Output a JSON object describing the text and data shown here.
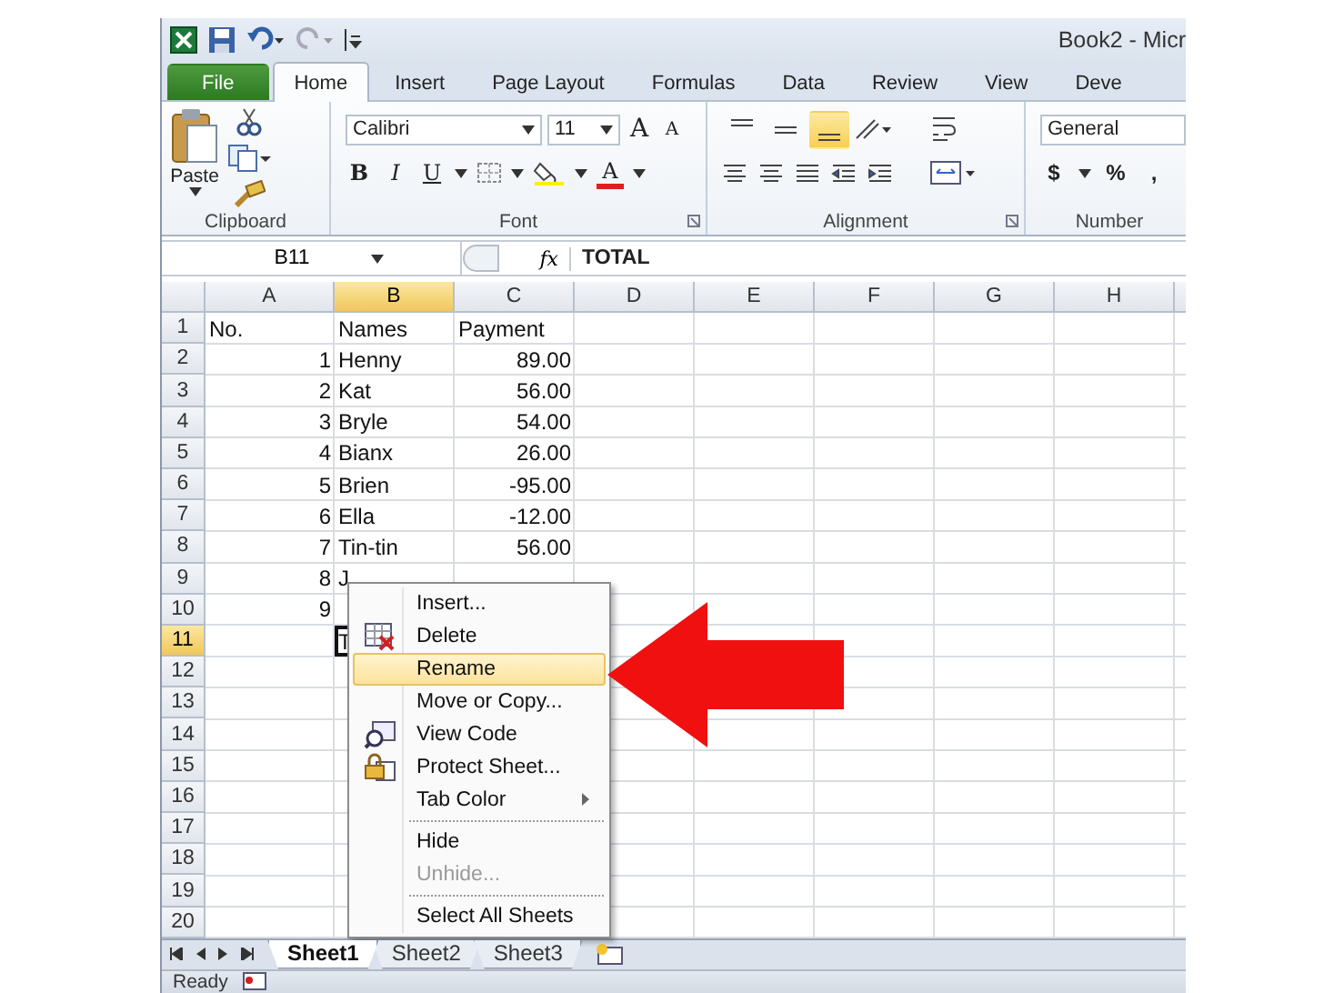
{
  "title_bar": {
    "title": "Book2 - Micr"
  },
  "ribbon_tabs": [
    {
      "label": "File",
      "kind": "file",
      "selected": false
    },
    {
      "label": "Home",
      "kind": "tab",
      "selected": true
    },
    {
      "label": "Insert",
      "kind": "tab",
      "selected": false
    },
    {
      "label": "Page Layout",
      "kind": "tab",
      "selected": false
    },
    {
      "label": "Formulas",
      "kind": "tab",
      "selected": false
    },
    {
      "label": "Data",
      "kind": "tab",
      "selected": false
    },
    {
      "label": "Review",
      "kind": "tab",
      "selected": false
    },
    {
      "label": "View",
      "kind": "tab",
      "selected": false
    },
    {
      "label": "Deve",
      "kind": "tab",
      "selected": false
    }
  ],
  "ribbon": {
    "clipboard": {
      "label": "Clipboard",
      "paste": "Paste"
    },
    "font": {
      "label": "Font",
      "name": "Calibri",
      "size": "11",
      "grow": "A",
      "shrink": "A",
      "bold": "B",
      "italic": "I",
      "underline": "U",
      "font_color": "A"
    },
    "alignment": {
      "label": "Alignment",
      "vertical_align": [
        {
          "selected": false
        },
        {
          "selected": false
        },
        {
          "selected": true
        }
      ]
    },
    "number": {
      "label": "Number",
      "format": "General",
      "currency": "$",
      "percent": "%",
      "comma": ","
    }
  },
  "formula_bar": {
    "name_box": "B11",
    "function_label": "fx",
    "formula": "TOTAL"
  },
  "sheet": {
    "columns": [
      {
        "label": "A",
        "selected": false
      },
      {
        "label": "B",
        "selected": true
      },
      {
        "label": "C",
        "selected": false
      },
      {
        "label": "D",
        "selected": false
      },
      {
        "label": "E",
        "selected": false
      },
      {
        "label": "F",
        "selected": false
      },
      {
        "label": "G",
        "selected": false
      },
      {
        "label": "H",
        "selected": false
      }
    ],
    "rows": [
      {
        "label": "1",
        "kind": "header",
        "selected": false,
        "cells": [
          {
            "text": "No.",
            "active": false
          },
          {
            "text": "Names",
            "active": false
          },
          {
            "text": "Payment",
            "active": false
          }
        ]
      },
      {
        "label": "2",
        "kind": "data",
        "selected": false,
        "cells": [
          {
            "text": "1",
            "active": false
          },
          {
            "text": "Henny",
            "active": false
          },
          {
            "text": "89.00",
            "active": false
          }
        ]
      },
      {
        "label": "3",
        "kind": "data",
        "selected": false,
        "cells": [
          {
            "text": "2",
            "active": false
          },
          {
            "text": "Kat",
            "active": false
          },
          {
            "text": "56.00",
            "active": false
          }
        ]
      },
      {
        "label": "4",
        "kind": "data",
        "selected": false,
        "cells": [
          {
            "text": "3",
            "active": false
          },
          {
            "text": "Bryle",
            "active": false
          },
          {
            "text": "54.00",
            "active": false
          }
        ]
      },
      {
        "label": "5",
        "kind": "data",
        "selected": false,
        "cells": [
          {
            "text": "4",
            "active": false
          },
          {
            "text": "Bianx",
            "active": false
          },
          {
            "text": "26.00",
            "active": false
          }
        ]
      },
      {
        "label": "6",
        "kind": "data",
        "selected": false,
        "cells": [
          {
            "text": "5",
            "active": false
          },
          {
            "text": "Brien",
            "active": false
          },
          {
            "text": "-95.00",
            "active": false
          }
        ]
      },
      {
        "label": "7",
        "kind": "data",
        "selected": false,
        "cells": [
          {
            "text": "6",
            "active": false
          },
          {
            "text": "Ella",
            "active": false
          },
          {
            "text": "-12.00",
            "active": false
          }
        ]
      },
      {
        "label": "8",
        "kind": "data",
        "selected": false,
        "cells": [
          {
            "text": "7",
            "active": false
          },
          {
            "text": "Tin-tin",
            "active": false
          },
          {
            "text": "56.00",
            "active": false
          }
        ]
      },
      {
        "label": "9",
        "kind": "data",
        "selected": false,
        "cells": [
          {
            "text": "8",
            "active": false
          },
          {
            "text": "J",
            "active": false
          }
        ]
      },
      {
        "label": "10",
        "kind": "data",
        "selected": false,
        "cells": [
          {
            "text": "9",
            "active": false
          }
        ]
      },
      {
        "label": "11",
        "kind": "data",
        "selected": true,
        "cells": [
          {
            "active": false
          },
          {
            "text": "T",
            "active": true
          }
        ]
      },
      {
        "label": "12",
        "kind": "data",
        "selected": false,
        "cells": []
      },
      {
        "label": "13",
        "kind": "data",
        "selected": false,
        "cells": []
      },
      {
        "label": "14",
        "kind": "data",
        "selected": false,
        "cells": []
      },
      {
        "label": "15",
        "kind": "data",
        "selected": false,
        "cells": []
      },
      {
        "label": "16",
        "kind": "data",
        "selected": false,
        "cells": []
      },
      {
        "label": "17",
        "kind": "data",
        "selected": false,
        "cells": []
      },
      {
        "label": "18",
        "kind": "data",
        "selected": false,
        "cells": []
      },
      {
        "label": "19",
        "kind": "data",
        "selected": false,
        "cells": []
      },
      {
        "label": "20",
        "kind": "data",
        "selected": false,
        "cells": []
      }
    ]
  },
  "context_menu": {
    "items": [
      {
        "label": "Insert...",
        "kind": "plain",
        "highlighted": false,
        "disabled": false,
        "submenu": false,
        "separator_before": false
      },
      {
        "label": "Delete",
        "kind": "delete",
        "highlighted": false,
        "disabled": false,
        "submenu": false,
        "separator_before": false
      },
      {
        "label": "Rename",
        "kind": "plain",
        "highlighted": true,
        "disabled": false,
        "submenu": false,
        "separator_before": false
      },
      {
        "label": "Move or Copy...",
        "kind": "plain",
        "highlighted": false,
        "disabled": false,
        "submenu": false,
        "separator_before": false
      },
      {
        "label": "View Code",
        "kind": "code",
        "highlighted": false,
        "disabled": false,
        "submenu": false,
        "separator_before": false
      },
      {
        "label": "Protect Sheet...",
        "kind": "protect",
        "highlighted": false,
        "disabled": false,
        "submenu": false,
        "separator_before": false
      },
      {
        "label": "Tab Color",
        "kind": "plain",
        "highlighted": false,
        "disabled": false,
        "submenu": true,
        "separator_before": false
      },
      {
        "label": "Hide",
        "kind": "plain",
        "highlighted": false,
        "disabled": false,
        "submenu": false,
        "separator_before": true
      },
      {
        "label": "Unhide...",
        "kind": "plain",
        "highlighted": false,
        "disabled": true,
        "submenu": false,
        "separator_before": false
      },
      {
        "label": "Select All Sheets",
        "kind": "plain",
        "highlighted": false,
        "disabled": false,
        "submenu": false,
        "separator_before": true
      }
    ]
  },
  "sheet_tabs": [
    {
      "label": "Sheet1",
      "selected": true
    },
    {
      "label": "Sheet2",
      "selected": false
    },
    {
      "label": "Sheet3",
      "selected": false
    }
  ],
  "status_bar": {
    "text": "Ready"
  }
}
